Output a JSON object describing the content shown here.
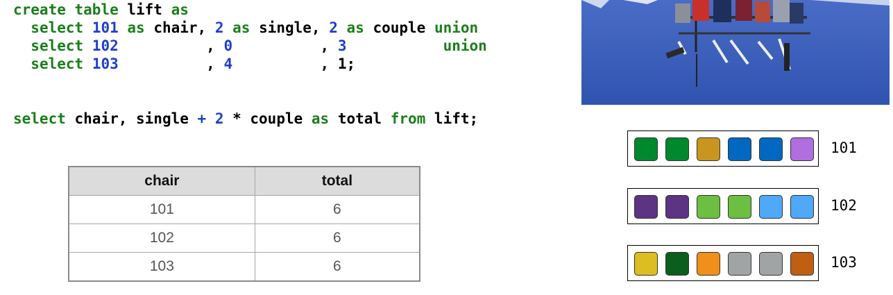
{
  "sql": {
    "create": [
      [
        [
          "kw",
          "create table "
        ],
        [
          "id",
          "lift "
        ],
        [
          "kw",
          "as"
        ]
      ],
      [
        [
          "t",
          "  "
        ],
        [
          "kw",
          "select "
        ],
        [
          "num",
          "101 "
        ],
        [
          "kw",
          "as "
        ],
        [
          "id",
          "chair, "
        ],
        [
          "num",
          "2 "
        ],
        [
          "kw",
          "as "
        ],
        [
          "id",
          "single, "
        ],
        [
          "num",
          "2 "
        ],
        [
          "kw",
          "as "
        ],
        [
          "id",
          "couple "
        ],
        [
          "kw",
          "union"
        ]
      ],
      [
        [
          "t",
          "  "
        ],
        [
          "kw",
          "select "
        ],
        [
          "num",
          "102"
        ],
        [
          "t",
          "          , "
        ],
        [
          "num",
          "0"
        ],
        [
          "t",
          "          , "
        ],
        [
          "num",
          "3"
        ],
        [
          "t",
          "           "
        ],
        [
          "kw",
          "union"
        ]
      ],
      [
        [
          "t",
          "  "
        ],
        [
          "kw",
          "select "
        ],
        [
          "num",
          "103"
        ],
        [
          "t",
          "          , "
        ],
        [
          "num",
          "4"
        ],
        [
          "t",
          "          , "
        ],
        [
          "t",
          "1;"
        ]
      ]
    ],
    "query": [
      [
        [
          "kw",
          "select "
        ],
        [
          "id",
          "chair, single "
        ],
        [
          "num",
          "+ 2 "
        ],
        [
          "id",
          "* couple "
        ],
        [
          "kw",
          "as "
        ],
        [
          "id",
          "total "
        ],
        [
          "kw",
          "from "
        ],
        [
          "id",
          "lift;"
        ]
      ]
    ]
  },
  "result_table": {
    "columns": [
      "chair",
      "total"
    ],
    "rows": [
      [
        "101",
        "6"
      ],
      [
        "102",
        "6"
      ],
      [
        "103",
        "6"
      ]
    ]
  },
  "chairs": [
    {
      "label": "101",
      "seats": [
        "#00882e",
        "#00882e",
        "#c8961e",
        "#0068c0",
        "#0068c0",
        "#b06ee0"
      ]
    },
    {
      "label": "102",
      "seats": [
        "#5c3483",
        "#5c3483",
        "#6cbf40",
        "#6cbf40",
        "#50a8f8",
        "#50a8f8"
      ]
    },
    {
      "label": "103",
      "seats": [
        "#dcbe22",
        "#0c5e1c",
        "#f0901a",
        "#a0a4a4",
        "#a0a4a4",
        "#c05e12"
      ]
    }
  ],
  "colors": {
    "keyword": "#1a7f1a",
    "number": "#1f3fc8",
    "sky": "#3a5cb8"
  },
  "icons": {
    "photo": "ski-lift-photo"
  }
}
